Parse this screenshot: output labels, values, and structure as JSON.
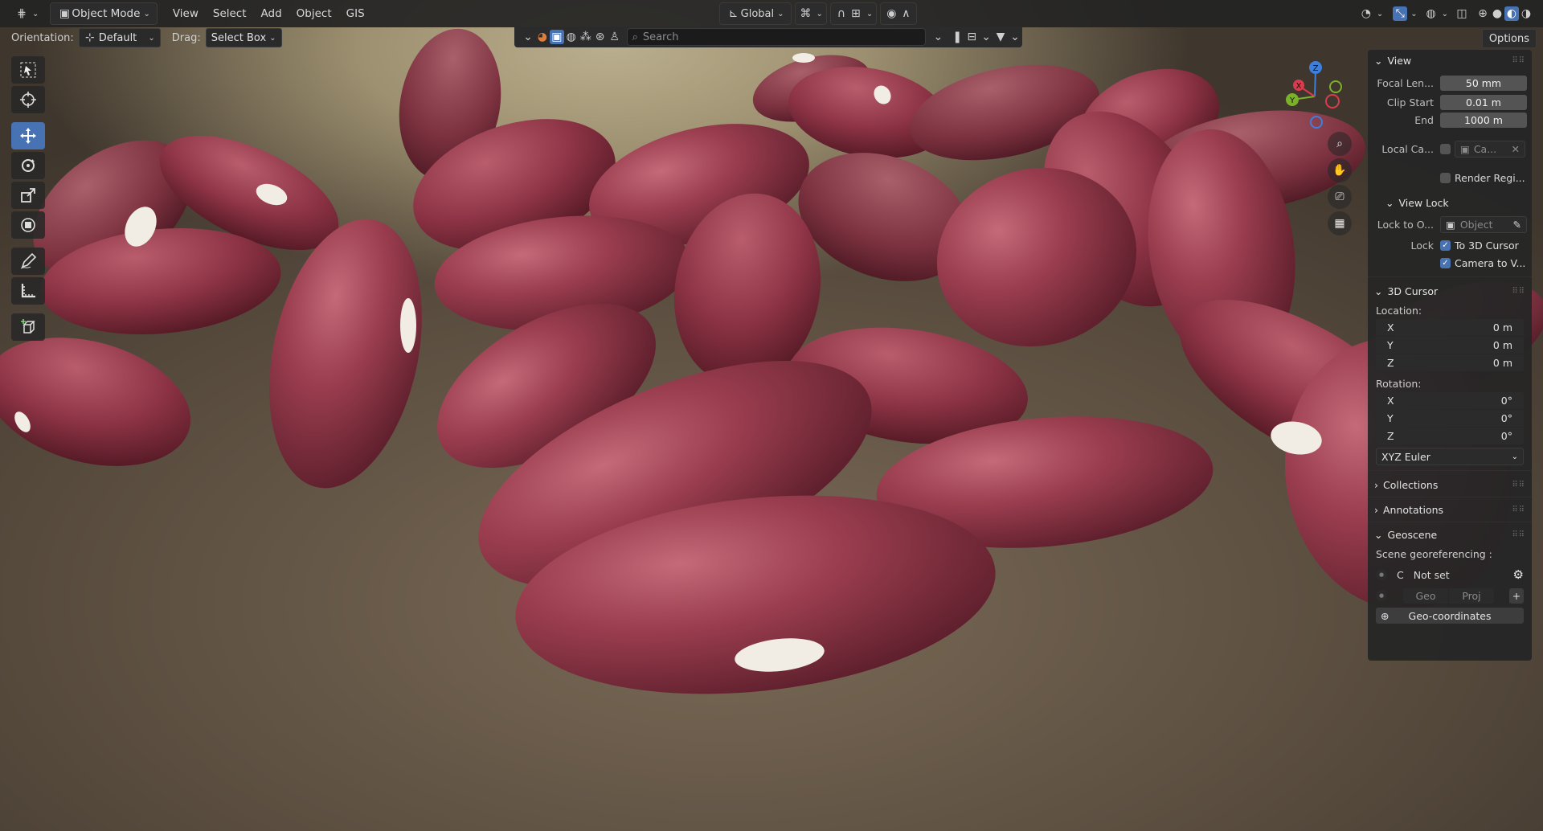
{
  "header": {
    "mode": "Object Mode",
    "menus": [
      "View",
      "Select",
      "Add",
      "Object",
      "GIS"
    ],
    "transform_orientation": "Global"
  },
  "tool_settings": {
    "orientation_label": "Orientation:",
    "orientation_value": "Default",
    "drag_label": "Drag:",
    "drag_value": "Select Box"
  },
  "outliner_bar": {
    "search_placeholder": "Search"
  },
  "options_label": "Options",
  "gizmo": {
    "x": "X",
    "y": "Y",
    "z": "Z"
  },
  "sidebar": {
    "view": {
      "title": "View",
      "focal_label": "Focal Len...",
      "focal_value": "50 mm",
      "clip_start_label": "Clip Start",
      "clip_start_value": "0.01 m",
      "clip_end_label": "End",
      "clip_end_value": "1000 m",
      "local_camera_label": "Local Ca...",
      "local_camera_value": "Ca...",
      "render_region_label": "Render Regi..."
    },
    "view_lock": {
      "title": "View Lock",
      "lock_to_object_label": "Lock to O...",
      "lock_to_object_placeholder": "Object",
      "lock_label": "Lock",
      "to_3d_cursor": "To 3D Cursor",
      "camera_to_view": "Camera to V..."
    },
    "cursor": {
      "title": "3D Cursor",
      "location_label": "Location:",
      "location": [
        {
          "axis": "X",
          "value": "0 m"
        },
        {
          "axis": "Y",
          "value": "0 m"
        },
        {
          "axis": "Z",
          "value": "0 m"
        }
      ],
      "rotation_label": "Rotation:",
      "rotation": [
        {
          "axis": "X",
          "value": "0°"
        },
        {
          "axis": "Y",
          "value": "0°"
        },
        {
          "axis": "Z",
          "value": "0°"
        }
      ],
      "rotation_mode": "XYZ Euler"
    },
    "collections_title": "Collections",
    "annotations_title": "Annotations",
    "geoscene": {
      "title": "Geoscene",
      "georef_label": "Scene georeferencing :",
      "c_label": "C",
      "status": "Not set",
      "geo_label": "Geo",
      "proj_label": "Proj",
      "geocoord_button": "Geo-coordinates"
    }
  },
  "colors": {
    "accent": "#4772b3",
    "bean_base": "#8a3345",
    "bean_light": "#b85b68",
    "hilum": "#f1ede4",
    "gizmo_x": "#d93b4f",
    "gizmo_y": "#7bb12a",
    "gizmo_z": "#3f7fdc"
  }
}
